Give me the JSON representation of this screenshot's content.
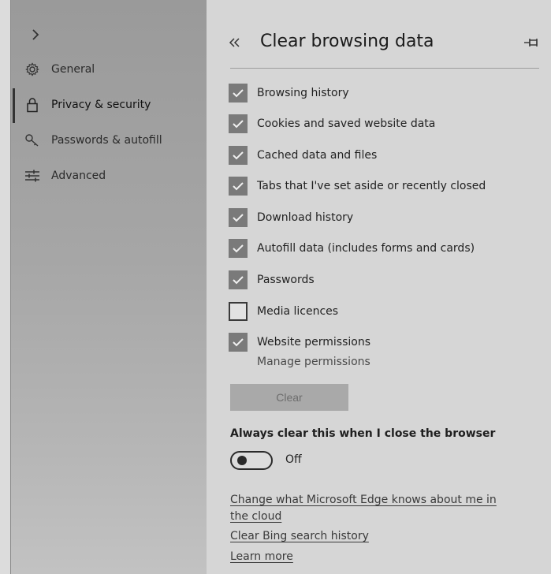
{
  "sidebar": {
    "expand_icon": "chevron-right-icon",
    "items": [
      {
        "label": "General",
        "icon": "gear-icon",
        "name": "sidebar-item-general"
      },
      {
        "label": "Privacy & security",
        "icon": "lock-icon",
        "name": "sidebar-item-privacy-security",
        "selected": true
      },
      {
        "label": "Passwords & autofill",
        "icon": "key-icon",
        "name": "sidebar-item-passwords-autofill"
      },
      {
        "label": "Advanced",
        "icon": "sliders-icon",
        "name": "sidebar-item-advanced"
      }
    ]
  },
  "panel": {
    "title": "Clear browsing data",
    "back_icon": "double-chevron-left-icon",
    "pin_icon": "pin-icon",
    "options": [
      {
        "label": "Browsing history",
        "checked": true
      },
      {
        "label": "Cookies and saved website data",
        "checked": true
      },
      {
        "label": "Cached data and files",
        "checked": true
      },
      {
        "label": "Tabs that I've set aside or recently closed",
        "checked": true
      },
      {
        "label": "Download history",
        "checked": true
      },
      {
        "label": "Autofill data (includes forms and cards)",
        "checked": true
      },
      {
        "label": "Passwords",
        "checked": true
      },
      {
        "label": "Media licences",
        "checked": false
      },
      {
        "label": "Website permissions",
        "checked": true
      }
    ],
    "manage_permissions_link": "Manage permissions",
    "clear_button": "Clear",
    "always_clear_heading": "Always clear this when I close the browser",
    "toggle_state": "Off",
    "links": {
      "edge_knows_line1": "Change what Microsoft Edge knows about me in",
      "edge_knows_line2": "the cloud",
      "clear_bing": "Clear Bing search history",
      "learn_more": "Learn more"
    }
  },
  "colors": {
    "sidebar_bg": "#a6a6a6",
    "panel_bg": "#d6d6d6",
    "checkbox_checked": "#7a7a7a",
    "clear_button_bg": "#a9a9a9"
  }
}
